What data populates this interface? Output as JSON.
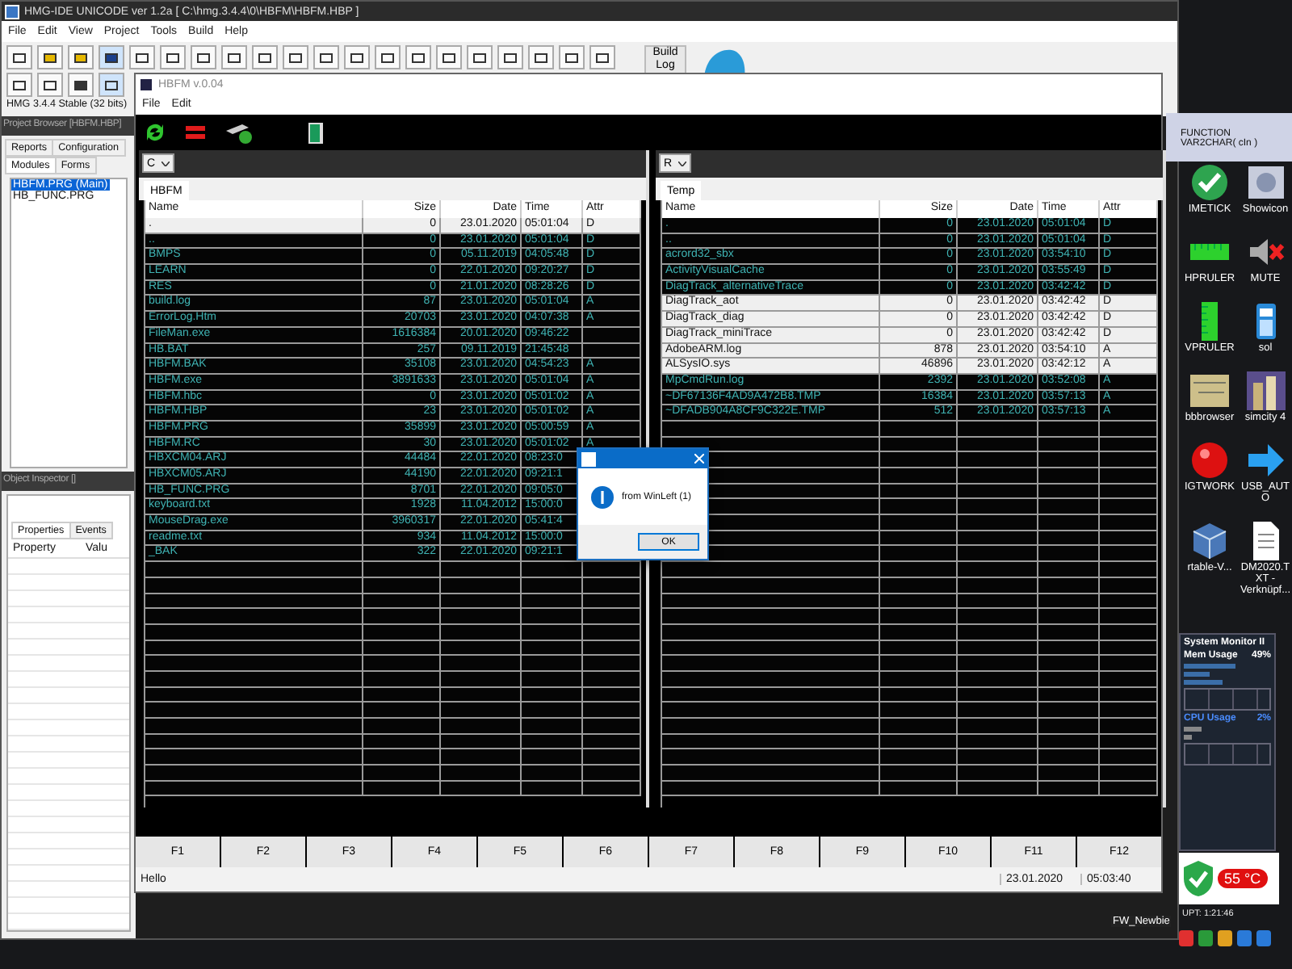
{
  "ide": {
    "title": "HMG-IDE  UNICODE  ver 1.2a  [ C:\\hmg.3.4.4\\0\\HBFM\\HBFM.HBP ]",
    "menu": [
      "File",
      "Edit",
      "View",
      "Project",
      "Tools",
      "Build",
      "Help"
    ],
    "build_button": "Build Log",
    "version": "HMG 3.4.4 Stable (32 bits)",
    "project_browser": {
      "title": "Project Browser [HBFM.HBP]",
      "tabs": [
        {
          "label": "Reports",
          "selected": false
        },
        {
          "label": "Configuration",
          "selected": false
        },
        {
          "label": "Modules",
          "selected": true
        },
        {
          "label": "Forms",
          "selected": false
        }
      ],
      "items": [
        {
          "label": "HBFM.PRG (Main)",
          "selected": true
        },
        {
          "label": "HB_FUNC.PRG",
          "selected": false
        }
      ]
    },
    "object_inspector": {
      "title": "Object Inspector []",
      "tabs": [
        {
          "label": "Properties",
          "selected": true
        },
        {
          "label": "Events",
          "selected": false
        }
      ],
      "columns": [
        "Property",
        "Valu"
      ]
    }
  },
  "hbfm": {
    "title": "HBFM v.0.04",
    "menu": [
      "File",
      "Edit"
    ],
    "panels": [
      {
        "drive": "C",
        "tab": "HBFM",
        "columns": [
          "Name",
          "Size",
          "Date",
          "Time",
          "Attr"
        ],
        "rows": [
          {
            "name": ".",
            "size": "0",
            "date": "23.01.2020",
            "time": "05:01:04",
            "attr": "D",
            "selected": true
          },
          {
            "name": "..",
            "size": "0",
            "date": "23.01.2020",
            "time": "05:01:04",
            "attr": "D",
            "selected": false
          },
          {
            "name": "BMPS",
            "size": "0",
            "date": "05.11.2019",
            "time": "04:05:48",
            "attr": "D",
            "selected": false
          },
          {
            "name": "LEARN",
            "size": "0",
            "date": "22.01.2020",
            "time": "09:20:27",
            "attr": "D",
            "selected": false
          },
          {
            "name": "RES",
            "size": "0",
            "date": "21.01.2020",
            "time": "08:28:26",
            "attr": "D",
            "selected": false
          },
          {
            "name": "build.log",
            "size": "87",
            "date": "23.01.2020",
            "time": "05:01:04",
            "attr": "A",
            "selected": false
          },
          {
            "name": "ErrorLog.Htm",
            "size": "20703",
            "date": "23.01.2020",
            "time": "04:07:38",
            "attr": "A",
            "selected": false
          },
          {
            "name": "FileMan.exe",
            "size": "1616384",
            "date": "20.01.2020",
            "time": "09:46:22",
            "selected": false
          },
          {
            "name": "HB.BAT",
            "size": "257",
            "date": "09.11.2019",
            "time": "21:45:48",
            "selected": false
          },
          {
            "name": "HBFM.BAK",
            "size": "35108",
            "date": "23.01.2020",
            "time": "04:54:23",
            "attr": "A",
            "selected": false
          },
          {
            "name": "HBFM.exe",
            "size": "3891633",
            "date": "23.01.2020",
            "time": "05:01:04",
            "attr": "A",
            "selected": false
          },
          {
            "name": "HBFM.hbc",
            "size": "0",
            "date": "23.01.2020",
            "time": "05:01:02",
            "attr": "A",
            "selected": false
          },
          {
            "name": "HBFM.HBP",
            "size": "23",
            "date": "23.01.2020",
            "time": "05:01:02",
            "attr": "A",
            "selected": false
          },
          {
            "name": "HBFM.PRG",
            "size": "35899",
            "date": "23.01.2020",
            "time": "05:00:59",
            "attr": "A",
            "selected": false
          },
          {
            "name": "HBFM.RC",
            "size": "30",
            "date": "23.01.2020",
            "time": "05:01:02",
            "attr": "A",
            "selected": false
          },
          {
            "name": "HBXCM04.ARJ",
            "size": "44484",
            "date": "22.01.2020",
            "time": "08:23:0",
            "selected": false
          },
          {
            "name": "HBXCM05.ARJ",
            "size": "44190",
            "date": "22.01.2020",
            "time": "09:21:1",
            "selected": false
          },
          {
            "name": "HB_FUNC.PRG",
            "size": "8701",
            "date": "22.01.2020",
            "time": "09:05:0",
            "selected": false
          },
          {
            "name": "keyboard.txt",
            "size": "1928",
            "date": "11.04.2012",
            "time": "15:00:0",
            "selected": false
          },
          {
            "name": "MouseDrag.exe",
            "size": "3960317",
            "date": "22.01.2020",
            "time": "05:41:4",
            "selected": false
          },
          {
            "name": "readme.txt",
            "size": "934",
            "date": "11.04.2012",
            "time": "15:00:0",
            "selected": false
          },
          {
            "name": "_BAK",
            "size": "322",
            "date": "22.01.2020",
            "time": "09:21:1",
            "selected": false
          }
        ]
      },
      {
        "drive": "R",
        "tab": "Temp",
        "columns": [
          "Name",
          "Size",
          "Date",
          "Time",
          "Attr"
        ],
        "rows": [
          {
            "name": ".",
            "size": "0",
            "date": "23.01.2020",
            "time": "05:01:04",
            "attr": "D",
            "selected": false
          },
          {
            "name": "..",
            "size": "0",
            "date": "23.01.2020",
            "time": "05:01:04",
            "attr": "D",
            "selected": false
          },
          {
            "name": "acrord32_sbx",
            "size": "0",
            "date": "23.01.2020",
            "time": "03:54:10",
            "attr": "D",
            "selected": false
          },
          {
            "name": "ActivityVisualCache",
            "size": "0",
            "date": "23.01.2020",
            "time": "03:55:49",
            "attr": "D",
            "selected": false
          },
          {
            "name": "DiagTrack_alternativeTrace",
            "size": "0",
            "date": "23.01.2020",
            "time": "03:42:42",
            "attr": "D",
            "selected": false
          },
          {
            "name": "DiagTrack_aot",
            "size": "0",
            "date": "23.01.2020",
            "time": "03:42:42",
            "attr": "D",
            "selected": true
          },
          {
            "name": "DiagTrack_diag",
            "size": "0",
            "date": "23.01.2020",
            "time": "03:42:42",
            "attr": "D",
            "selected": true
          },
          {
            "name": "DiagTrack_miniTrace",
            "size": "0",
            "date": "23.01.2020",
            "time": "03:42:42",
            "attr": "D",
            "selected": true
          },
          {
            "name": "AdobeARM.log",
            "size": "878",
            "date": "23.01.2020",
            "time": "03:54:10",
            "attr": "A",
            "selected": true
          },
          {
            "name": "ALSysIO.sys",
            "size": "46896",
            "date": "23.01.2020",
            "time": "03:42:12",
            "attr": "A",
            "selected": true
          },
          {
            "name": "MpCmdRun.log",
            "size": "2392",
            "date": "23.01.2020",
            "time": "03:52:08",
            "attr": "A",
            "selected": false
          },
          {
            "name": "~DF67136F4AD9A472B8.TMP",
            "size": "16384",
            "date": "23.01.2020",
            "time": "03:57:13",
            "attr": "A",
            "selected": false
          },
          {
            "name": "~DFADB904A8CF9C322E.TMP",
            "size": "512",
            "date": "23.01.2020",
            "time": "03:57:13",
            "attr": "A",
            "selected": false
          }
        ]
      }
    ],
    "function_keys": [
      "F1",
      "F2",
      "F3",
      "F4",
      "F5",
      "F6",
      "F7",
      "F8",
      "F9",
      "F10",
      "F11",
      "F12"
    ],
    "status": {
      "message": "Hello",
      "date": "23.01.2020",
      "time": "05:03:40"
    }
  },
  "dialog": {
    "message": "from WinLeft (1)",
    "button": "OK"
  },
  "desktop": {
    "note": [
      "FUNCTION",
      "VAR2CHAR( cIn )"
    ],
    "icons": [
      {
        "label": "IMETICK",
        "kind": "check"
      },
      {
        "label": "Showicon",
        "kind": "disc"
      },
      {
        "label": "HPRULER",
        "kind": "hruler"
      },
      {
        "label": "MUTE",
        "kind": "mute"
      },
      {
        "label": "VPRULER",
        "kind": "vruler"
      },
      {
        "label": "sol",
        "kind": "robot"
      },
      {
        "label": "bbbrowser",
        "kind": "map"
      },
      {
        "label": "simcity 4",
        "kind": "city"
      },
      {
        "label": "IGTWORK",
        "kind": "ball"
      },
      {
        "label": "USB_AUTO",
        "kind": "arrow"
      },
      {
        "label": "rtable-V...",
        "kind": "cube"
      },
      {
        "label": "DM2020.TXT - Verknüpf...",
        "kind": "doc"
      }
    ],
    "system_monitor": {
      "title": "System Monitor II",
      "mem_label": "Mem Usage",
      "mem_value": "49%",
      "cpu_label": "CPU Usage",
      "cpu_value": "2%",
      "temperature": "55 °C",
      "uptime": "UPT: 1:21:46"
    },
    "shortcut": "FW_Newbie"
  }
}
